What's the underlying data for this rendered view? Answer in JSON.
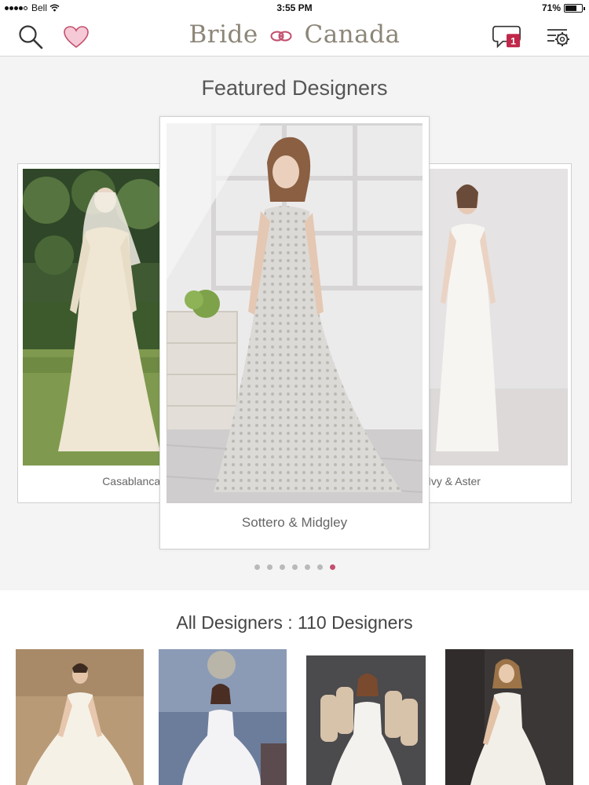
{
  "status_bar": {
    "carrier": "Bell",
    "time": "3:55 PM",
    "battery": "71%",
    "battery_level": 0.71
  },
  "header": {
    "logo_left": "Bride",
    "logo_right": "Canada",
    "message_count": "1",
    "icons": [
      "search-icon",
      "heart-icon",
      "chat-icon",
      "settings-icon"
    ]
  },
  "featured": {
    "title": "Featured Designers",
    "cards": [
      {
        "name": "Casablanca Bridal"
      },
      {
        "name": "Sottero & Midgley"
      },
      {
        "name": "Ivy & Aster"
      }
    ],
    "page_count": 7,
    "active_page": 7
  },
  "all_designers": {
    "title": "All Designers : 110 Designers"
  },
  "colors": {
    "accent": "#c2506e",
    "badge": "#c0284a",
    "logo": "#8c8678"
  }
}
